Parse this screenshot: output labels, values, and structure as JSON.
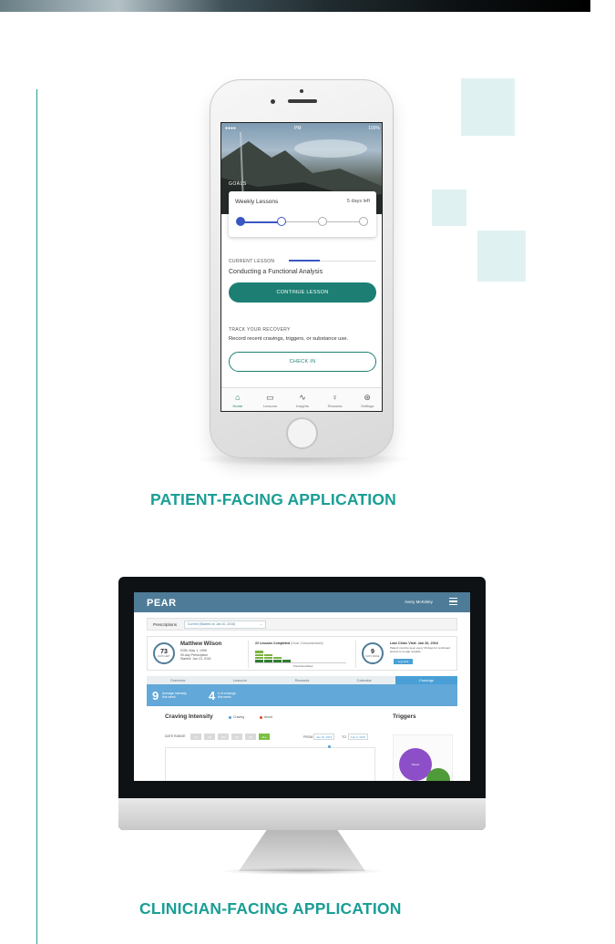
{
  "colors": {
    "accent": "#199e95",
    "primary_button": "#1d7f73",
    "clinician_header": "#4e7c98",
    "clinician_tab_active": "#4aa0d6"
  },
  "patient_app": {
    "status_bar": {
      "time": "PM",
      "battery": "100%"
    },
    "goals_label": "GOALS",
    "weekly_card": {
      "title": "Weekly Lessons",
      "days_left": "5 days left",
      "progress_completed": 1,
      "progress_current": 2,
      "progress_total": 4
    },
    "current_lesson": {
      "label": "CURRENT LESSON",
      "title": "Conducting a Functional Analysis",
      "button": "CONTINUE LESSON",
      "progress": 0.35
    },
    "track_recovery": {
      "label": "TRACK YOUR RECOVERY",
      "text": "Record recent cravings, triggers, or substance use.",
      "button": "CHECK IN"
    },
    "tabs": [
      {
        "label": "Home",
        "icon": "home-icon",
        "active": true
      },
      {
        "label": "Lessons",
        "icon": "book-icon",
        "active": false
      },
      {
        "label": "Insights",
        "icon": "chart-icon",
        "active": false
      },
      {
        "label": "Rewards",
        "icon": "ribbon-icon",
        "active": false
      },
      {
        "label": "Settings",
        "icon": "settings-icon",
        "active": false
      }
    ]
  },
  "patient_caption": "PATIENT-FACING APPLICATION",
  "clinician_app": {
    "logo": "PEAR",
    "user_name": "Avery McKinley",
    "prescriptions_label": "Prescriptions",
    "prescription_select": "Current (Started on Jan 10, 2016)",
    "patient": {
      "days_left": "73",
      "days_label": "DAYS LEFT",
      "name": "Matthew Wilson",
      "dob": "DOB: May 1, 1996",
      "rx": "90-day Prescription",
      "started": "Started: Jan 10, 2016",
      "lessons_title": "22 Lessons Completed",
      "lessons_goal": "(Goal: 4 lessons/week)",
      "prescribed_week": "Prescribed Week",
      "weekly_lessons": [
        4,
        3,
        2,
        1
      ],
      "since_days": "9",
      "since_label": "DAYS SINCE",
      "last_visit": "Last Clinic Visit: Jan 26, 2016",
      "last_visit_note": "Patient must be seen every 30 days for continued access to re-app rewards.",
      "log_visit": "Log Visit"
    },
    "tabs": [
      "Overview",
      "Lessons",
      "Rewards",
      "Calendar",
      "Cravings"
    ],
    "active_tab": "Cravings",
    "stats": [
      {
        "value": "9",
        "label": "Average intensity this week"
      },
      {
        "value": "4",
        "label": "# of cravings this week"
      }
    ],
    "craving_title": "Craving Intensity",
    "legend": [
      {
        "label": "Craving",
        "color": "#4aa0d6"
      },
      {
        "label": "Avoid",
        "color": "#e8412c"
      }
    ],
    "range_label": "DATE RANGE",
    "range_buttons": [
      "1D",
      "1W",
      "2W",
      "1M",
      "3M",
      "ALL"
    ],
    "from_label": "FROM",
    "from_date": "Jan 10, 2016",
    "to_label": "TO",
    "to_date": "Feb 9, 2016",
    "triggers_title": "Triggers",
    "trigger_bubble": "Stress"
  },
  "clinician_caption": "CLINICIAN-FACING APPLICATION"
}
